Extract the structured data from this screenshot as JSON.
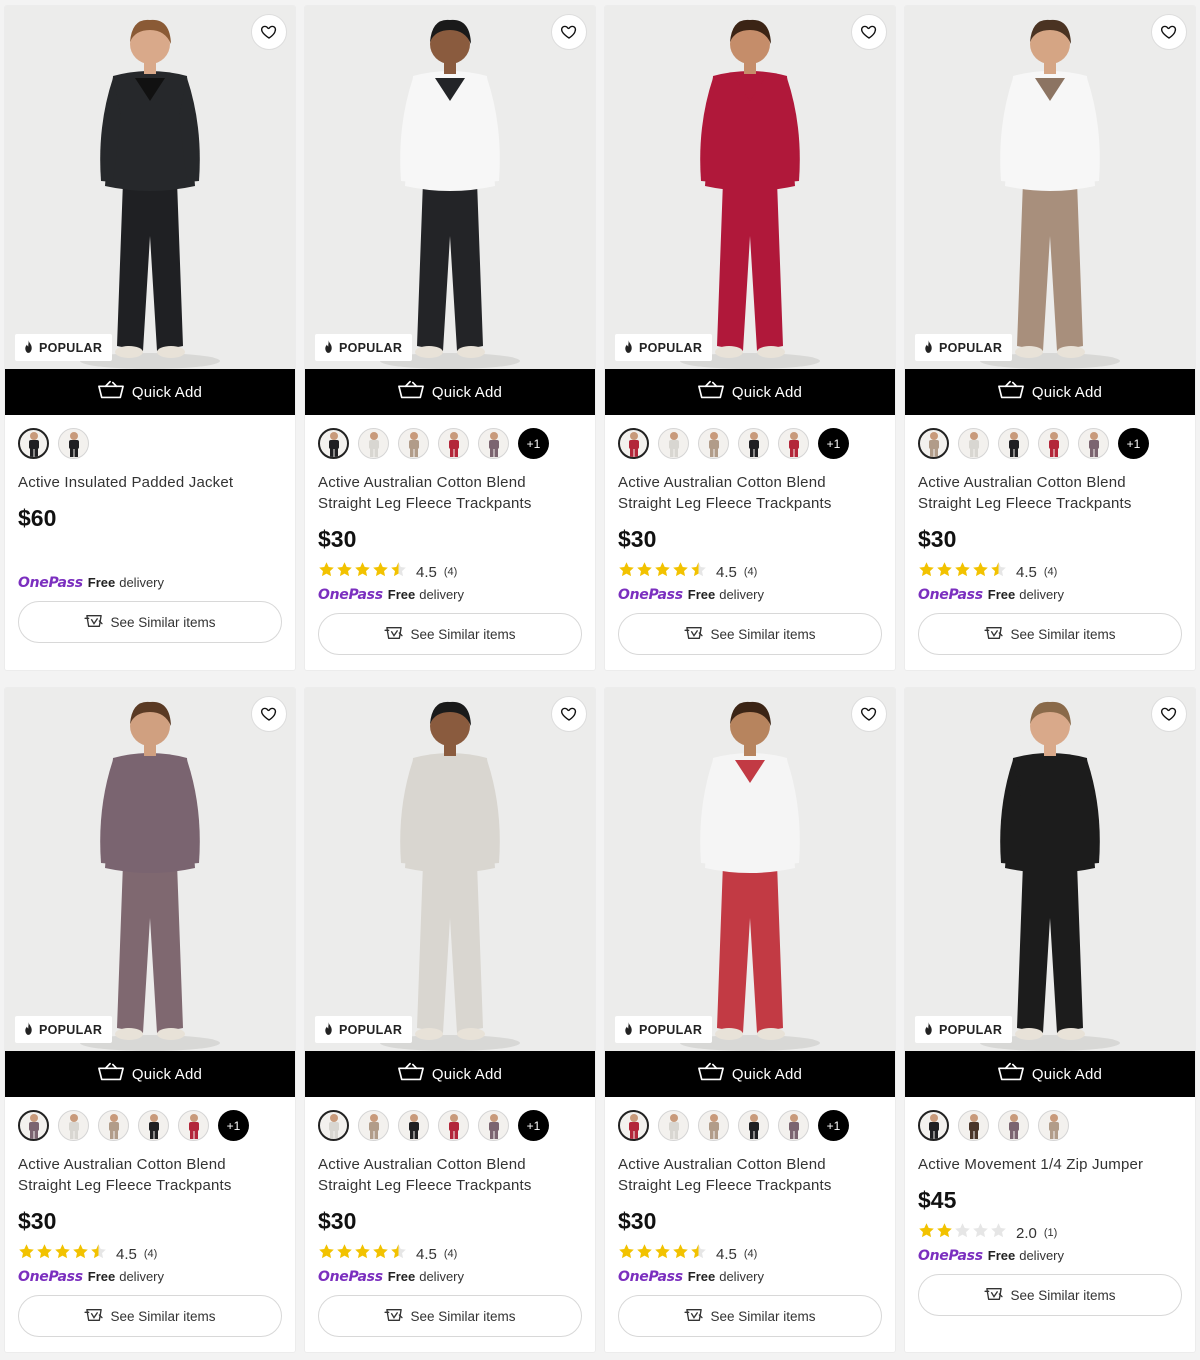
{
  "colors": {
    "onepass": "#7b2fbf",
    "star": "#f2c200",
    "quick_add_bg": "#000000"
  },
  "labels": {
    "popular": "POPULAR",
    "quick_add": "Quick Add",
    "see_similar": "See Similar items",
    "onepass": "OnePass",
    "free": "Free",
    "delivery": "delivery"
  },
  "products": [
    {
      "name": "Active Insulated Padded Jacket",
      "price": "$60",
      "rating": null,
      "count": null,
      "swatches": [
        "black",
        "black"
      ],
      "more": null
    },
    {
      "name": "Active Australian Cotton Blend Straight Leg Fleece Trackpants",
      "price": "$30",
      "rating": "4.5",
      "count": "(4)",
      "swatches": [
        "black",
        "grey",
        "taupe",
        "red",
        "mauve"
      ],
      "more": "+1"
    },
    {
      "name": "Active Australian Cotton Blend Straight Leg Fleece Trackpants",
      "price": "$30",
      "rating": "4.5",
      "count": "(4)",
      "swatches": [
        "red",
        "grey",
        "taupe",
        "black",
        "red"
      ],
      "more": "+1"
    },
    {
      "name": "Active Australian Cotton Blend Straight Leg Fleece Trackpants",
      "price": "$30",
      "rating": "4.5",
      "count": "(4)",
      "swatches": [
        "taupe",
        "grey",
        "black",
        "red",
        "mauve"
      ],
      "more": "+1"
    },
    {
      "name": "Active Australian Cotton Blend Straight Leg Fleece Trackpants",
      "price": "$30",
      "rating": "4.5",
      "count": "(4)",
      "swatches": [
        "mauve",
        "grey",
        "taupe",
        "black",
        "red"
      ],
      "more": "+1"
    },
    {
      "name": "Active Australian Cotton Blend Straight Leg Fleece Trackpants",
      "price": "$30",
      "rating": "4.5",
      "count": "(4)",
      "swatches": [
        "grey",
        "taupe",
        "black",
        "red",
        "mauve"
      ],
      "more": "+1"
    },
    {
      "name": "Active Australian Cotton Blend Straight Leg Fleece Trackpants",
      "price": "$30",
      "rating": "4.5",
      "count": "(4)",
      "swatches": [
        "red",
        "grey",
        "taupe",
        "black",
        "mauve"
      ],
      "more": "+1"
    },
    {
      "name": "Active Movement 1/4 Zip Jumper",
      "price": "$45",
      "rating": "2.0",
      "count": "(1)",
      "swatches": [
        "black",
        "brown",
        "mauve",
        "taupe"
      ],
      "more": null
    }
  ],
  "product_images": [
    {
      "top": "#26282b",
      "bottom": "#1f2023",
      "skin": "#d9a98a",
      "hair": "#8a5a35",
      "inner": "#111111"
    },
    {
      "top": "#f7f7f7",
      "bottom": "#232427",
      "skin": "#8a5b3e",
      "hair": "#1a1a1a",
      "inner": "#232427"
    },
    {
      "top": "#b0183a",
      "bottom": "#b0183a",
      "skin": "#c58d6a",
      "hair": "#3b2415",
      "inner": "#b0183a"
    },
    {
      "top": "#f7f7f7",
      "bottom": "#a88f7c",
      "skin": "#d5a584",
      "hair": "#4a3322",
      "inner": "#8c7462"
    },
    {
      "top": "#7a6470",
      "bottom": "#7f6870",
      "skin": "#d0a080",
      "hair": "#5a3a24",
      "inner": "#7a6470"
    },
    {
      "top": "#d9d6d0",
      "bottom": "#d9d6d0",
      "skin": "#8a5b3e",
      "hair": "#1a1a1a",
      "inner": "#d9d6d0"
    },
    {
      "top": "#f5f5f5",
      "bottom": "#c23a44",
      "skin": "#b7845e",
      "hair": "#3b2415",
      "inner": "#c23a44"
    },
    {
      "top": "#1c1c1c",
      "bottom": "#1c1c1c",
      "skin": "#d9a98a",
      "hair": "#8a6a4a",
      "inner": "#1c1c1c"
    }
  ]
}
